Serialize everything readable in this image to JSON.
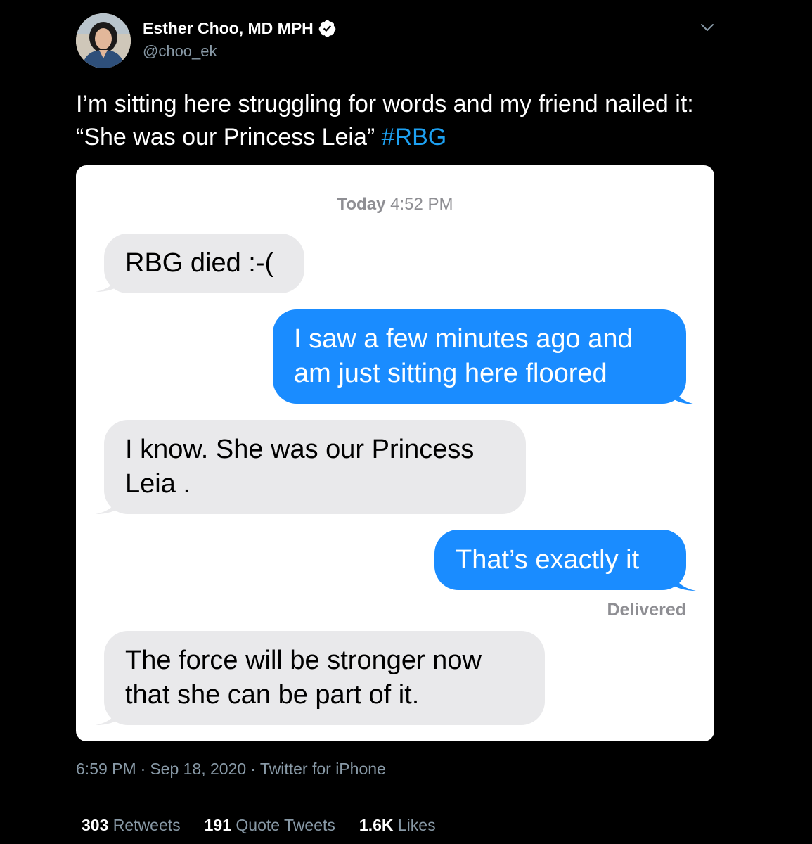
{
  "author": {
    "name": "Esther Choo, MD MPH",
    "handle": "@choo_ek",
    "verified": true
  },
  "tweet": {
    "text": "I’m sitting here struggling for words and my friend nailed it: “She was our Princess Leia” ",
    "hashtag": "#RBG"
  },
  "media": {
    "timestamp_bold": "Today",
    "timestamp_time": " 4:52 PM",
    "messages": [
      {
        "direction": "incoming",
        "line1": "RBG died :-(",
        "line2": ""
      },
      {
        "direction": "outgoing",
        "line1": "I saw a few minutes ago and",
        "line2": "am just sitting here floored"
      },
      {
        "direction": "incoming",
        "line1": "I know. She was our Princess",
        "line2": "Leia ."
      },
      {
        "direction": "outgoing",
        "line1": "That’s exactly it",
        "line2": ""
      },
      {
        "direction": "incoming",
        "line1": "The force will be stronger now",
        "line2": "that she can be part of it."
      }
    ],
    "delivered_label": "Delivered"
  },
  "meta": {
    "time": "6:59 PM",
    "date": "Sep 18, 2020",
    "source": "Twitter for iPhone",
    "separator": "·"
  },
  "stats": {
    "retweets_count": "303",
    "retweets_label": " Retweets",
    "quotes_count": "191",
    "quotes_label": " Quote Tweets",
    "likes_count": "1.6K",
    "likes_label": " Likes"
  },
  "colors": {
    "background": "#000000",
    "link": "#1da1f2",
    "secondary_text": "#8899a6",
    "imessage_blue": "#1a8cff",
    "imessage_gray": "#e9e9eb"
  },
  "icons": {
    "verified": "verified-badge-icon",
    "more": "chevron-down-icon"
  }
}
